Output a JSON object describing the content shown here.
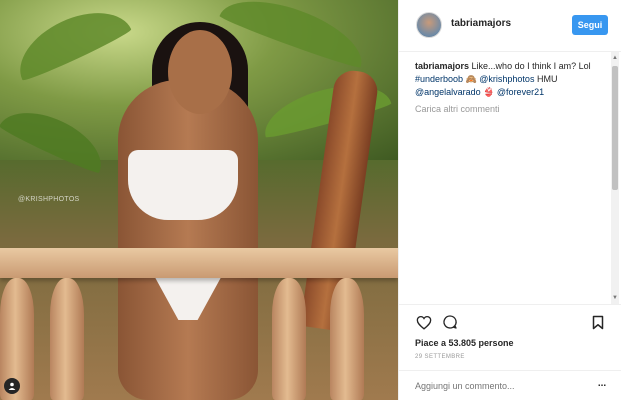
{
  "photo": {
    "watermark": "@KRISHPHOTOS"
  },
  "header": {
    "username": "tabriamajors",
    "follow_label": "Segui"
  },
  "caption": {
    "username": "tabriamajors",
    "text_1": "Like...who do I think I am? Lol",
    "hashtag": "#underboob",
    "text_2": "🙈 ",
    "mention_1": "@krishphotos",
    "text_3": " HMU",
    "mention_2": "@angelalvarado",
    "text_4": " 👙 ",
    "mention_3": "@forever21"
  },
  "load_more_label": "Carica altri commenti",
  "likes_text": "Piace a 53.805 persone",
  "date_text": "29 SETTEMBRE",
  "comment": {
    "placeholder": "Aggiungi un commento..."
  },
  "more_label": "..."
}
